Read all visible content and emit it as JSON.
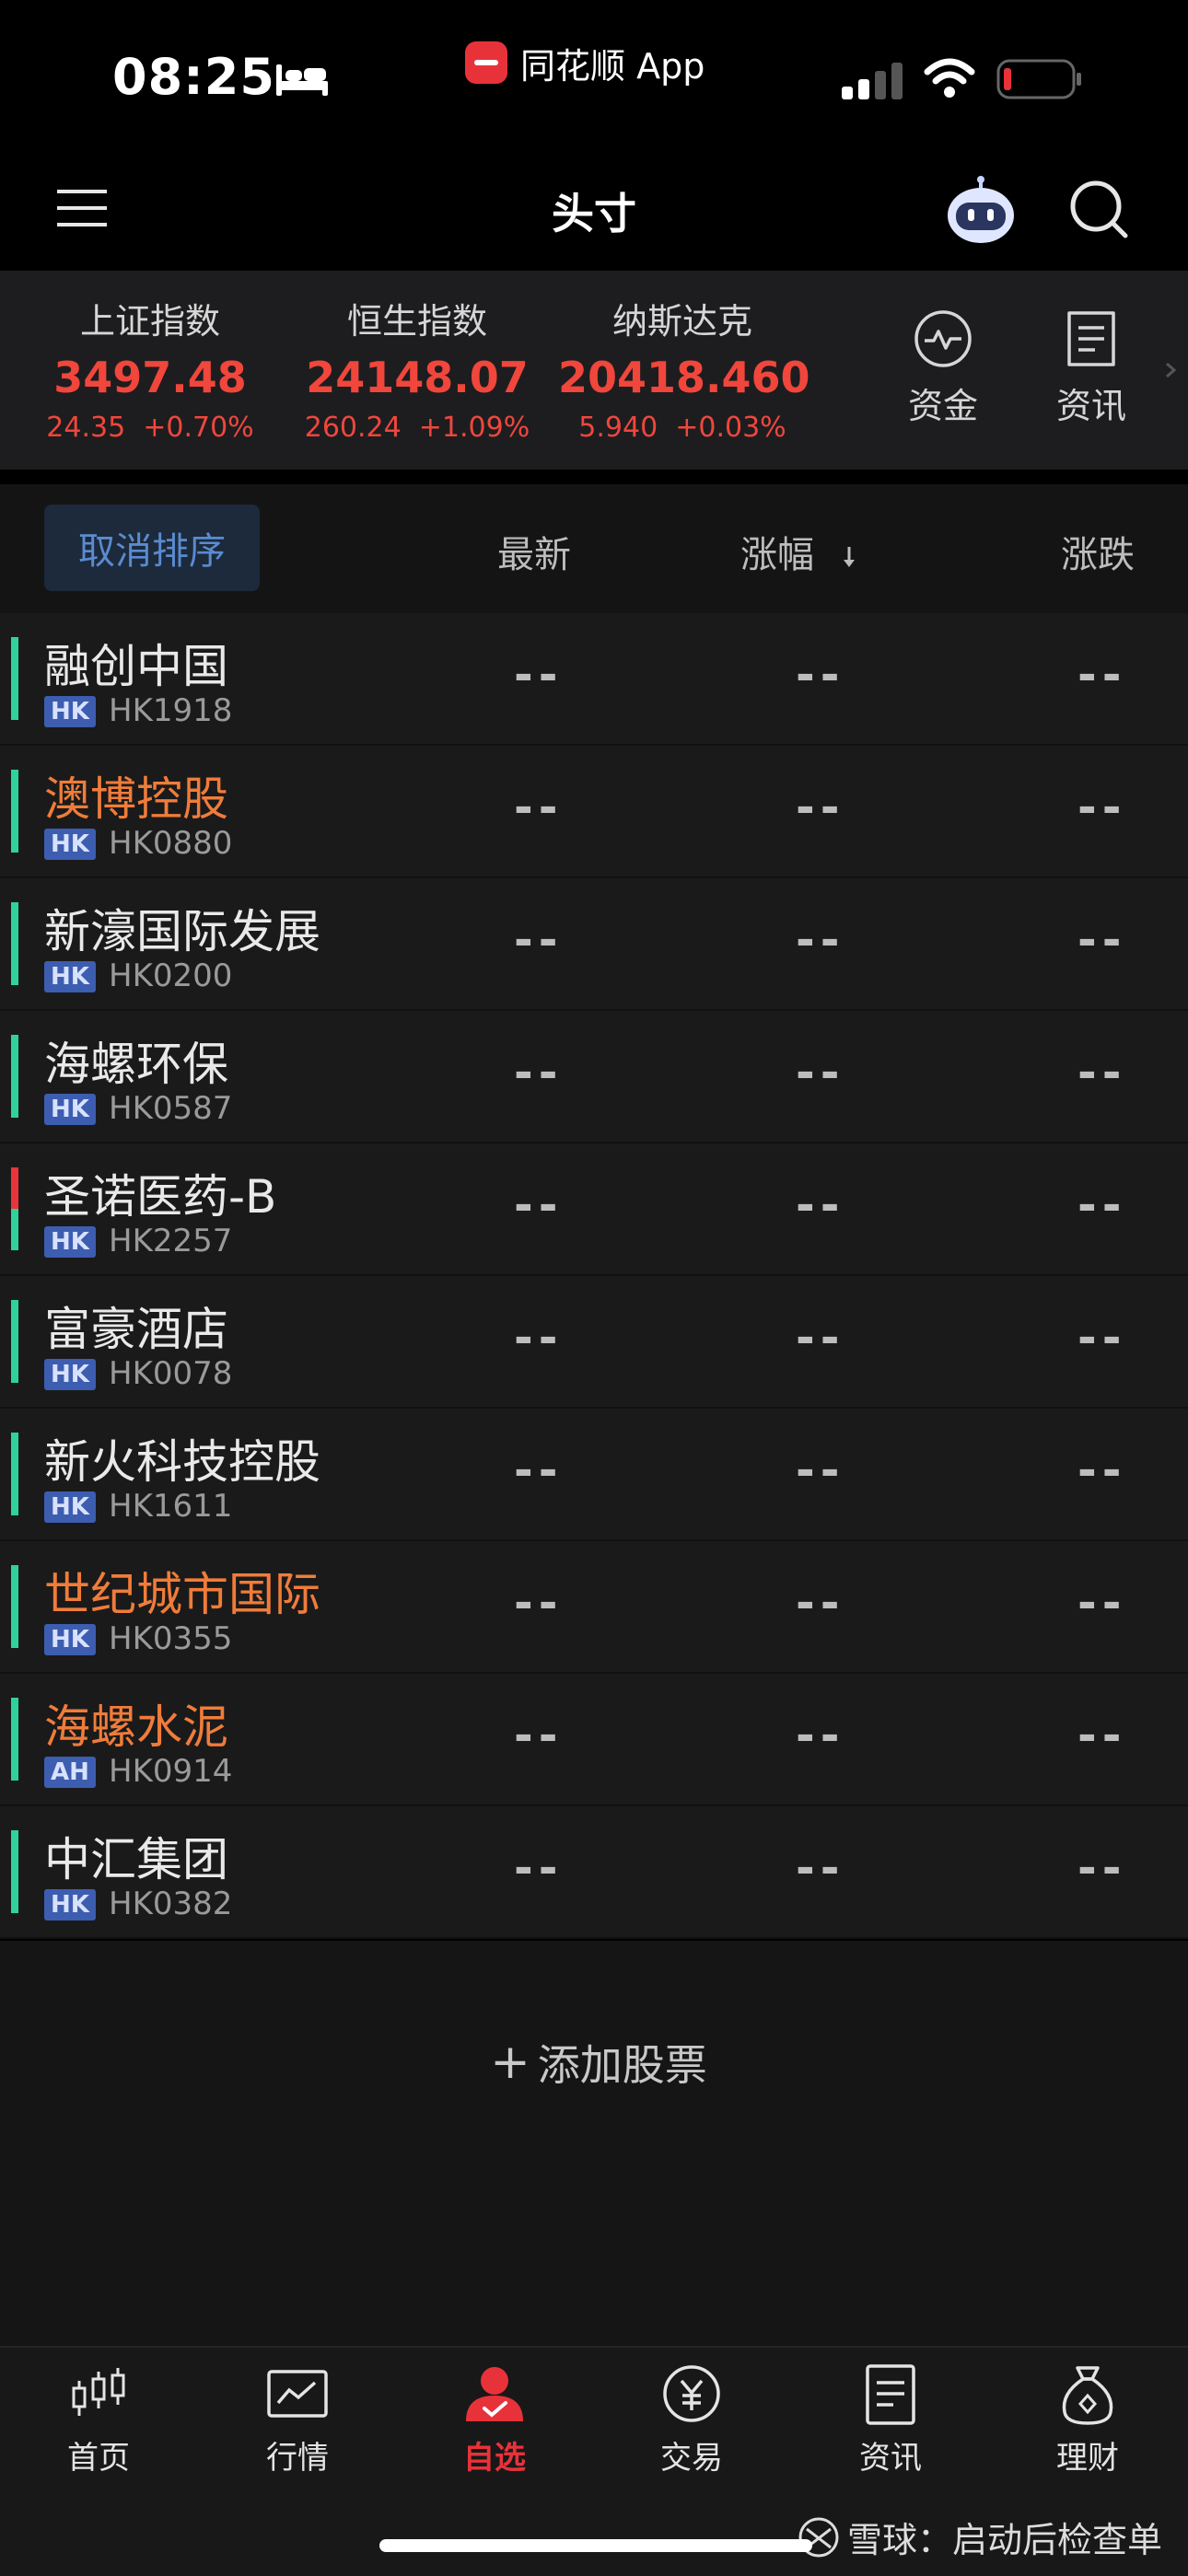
{
  "status_bar": {
    "time": "08:25",
    "app_name": "同花顺 App"
  },
  "header": {
    "title": "头寸"
  },
  "indices": [
    {
      "name": "上证指数",
      "value": "3497.48",
      "change": "24.35",
      "percent": "+0.70%"
    },
    {
      "name": "恒生指数",
      "value": "24148.07",
      "change": "260.24",
      "percent": "+1.09%"
    },
    {
      "name": "纳斯达克",
      "value": "20418.460",
      "change": "5.940",
      "percent": "+0.03%"
    }
  ],
  "quick_tools": [
    {
      "label": "资金"
    },
    {
      "label": "资讯"
    }
  ],
  "list_header": {
    "cancel_sort": "取消排序",
    "col_latest": "最新",
    "col_change_pct": "涨幅",
    "col_change": "涨跌"
  },
  "stocks": [
    {
      "name": "融创中国",
      "market": "HK",
      "code": "HK1918",
      "latest": "--",
      "change_pct": "--",
      "change": "--"
    },
    {
      "name": "澳博控股",
      "market": "HK",
      "code": "HK0880",
      "latest": "--",
      "change_pct": "--",
      "change": "--"
    },
    {
      "name": "新濠国际发展",
      "market": "HK",
      "code": "HK0200",
      "latest": "--",
      "change_pct": "--",
      "change": "--"
    },
    {
      "name": "海螺环保",
      "market": "HK",
      "code": "HK0587",
      "latest": "--",
      "change_pct": "--",
      "change": "--"
    },
    {
      "name": "圣诺医药-B",
      "market": "HK",
      "code": "HK2257",
      "latest": "--",
      "change_pct": "--",
      "change": "--"
    },
    {
      "name": "富豪酒店",
      "market": "HK",
      "code": "HK0078",
      "latest": "--",
      "change_pct": "--",
      "change": "--"
    },
    {
      "name": "新火科技控股",
      "market": "HK",
      "code": "HK1611",
      "latest": "--",
      "change_pct": "--",
      "change": "--"
    },
    {
      "name": "世纪城市国际",
      "market": "HK",
      "code": "HK0355",
      "latest": "--",
      "change_pct": "--",
      "change": "--"
    },
    {
      "name": "海螺水泥",
      "market": "AH",
      "code": "HK0914",
      "latest": "--",
      "change_pct": "--",
      "change": "--"
    },
    {
      "name": "中汇集团",
      "market": "HK",
      "code": "HK0382",
      "latest": "--",
      "change_pct": "--",
      "change": "--"
    }
  ],
  "add_stock": {
    "label": "添加股票"
  },
  "tabs": [
    {
      "label": "首页",
      "icon": "candlestick-icon"
    },
    {
      "label": "行情",
      "icon": "chart-icon"
    },
    {
      "label": "自选",
      "icon": "person-check-icon"
    },
    {
      "label": "交易",
      "icon": "yen-icon"
    },
    {
      "label": "资讯",
      "icon": "document-icon"
    },
    {
      "label": "理财",
      "icon": "money-bag-icon"
    }
  ],
  "watermark": {
    "text": "雪球：启动后检查单"
  },
  "colors": {
    "up": "#f0463c",
    "down": "#2fd29b",
    "accent": "#e8323a",
    "orange_name": "#f07c3a",
    "badge": "#3d5db0"
  }
}
